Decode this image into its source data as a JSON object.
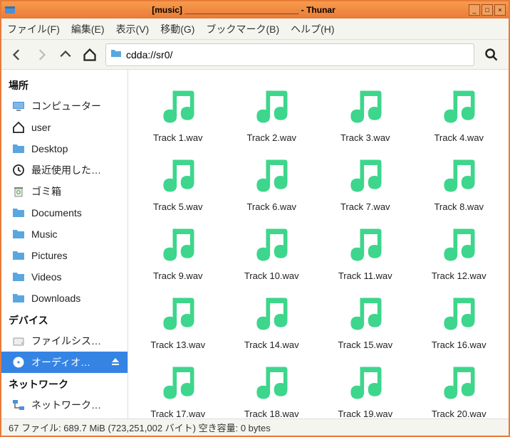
{
  "titlebar": {
    "text": "[music] ________________________ - Thunar"
  },
  "menubar": {
    "items": [
      "ファイル(F)",
      "編集(E)",
      "表示(V)",
      "移動(G)",
      "ブックマーク(B)",
      "ヘルプ(H)"
    ]
  },
  "address": {
    "path": "cdda://sr0/"
  },
  "sidebar": {
    "sections": [
      {
        "title": "場所",
        "items": [
          {
            "label": "コンピューター",
            "icon": "computer"
          },
          {
            "label": "user",
            "icon": "home"
          },
          {
            "label": "Desktop",
            "icon": "folder"
          },
          {
            "label": "最近使用した…",
            "icon": "clock"
          },
          {
            "label": "ゴミ箱",
            "icon": "trash"
          },
          {
            "label": "Documents",
            "icon": "folder"
          },
          {
            "label": "Music",
            "icon": "folder"
          },
          {
            "label": "Pictures",
            "icon": "folder"
          },
          {
            "label": "Videos",
            "icon": "folder"
          },
          {
            "label": "Downloads",
            "icon": "folder"
          }
        ]
      },
      {
        "title": "デバイス",
        "items": [
          {
            "label": "ファイルシス…",
            "icon": "disk"
          },
          {
            "label": "オーディオ…",
            "icon": "cd",
            "selected": true,
            "eject": true
          }
        ]
      },
      {
        "title": "ネットワーク",
        "items": [
          {
            "label": "ネットワーク…",
            "icon": "network"
          }
        ]
      }
    ]
  },
  "files": [
    "Track 1.wav",
    "Track 2.wav",
    "Track 3.wav",
    "Track 4.wav",
    "Track 5.wav",
    "Track 6.wav",
    "Track 7.wav",
    "Track 8.wav",
    "Track 9.wav",
    "Track 10.wav",
    "Track 11.wav",
    "Track 12.wav",
    "Track 13.wav",
    "Track 14.wav",
    "Track 15.wav",
    "Track 16.wav",
    "Track 17.wav",
    "Track 18.wav",
    "Track 19.wav",
    "Track 20.wav"
  ],
  "statusbar": {
    "text": "67 ファイル: 689.7 MiB (723,251,002 バイト)   空き容量: 0 bytes"
  },
  "colors": {
    "accent": "#e87b3a",
    "selection": "#3584e4",
    "music_icon": "#3dd68c"
  }
}
